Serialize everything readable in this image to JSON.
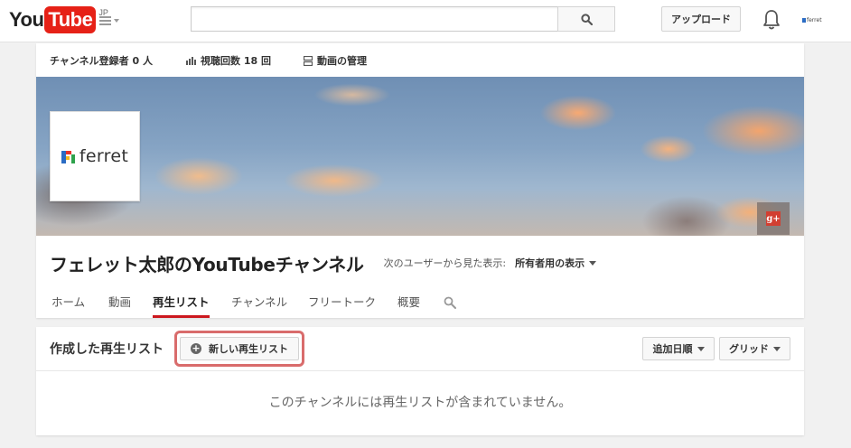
{
  "masthead": {
    "logo_you": "You",
    "logo_tube": "Tube",
    "logo_region": "JP",
    "search_placeholder": "",
    "upload_label": "アップロード",
    "account_name": "ferret"
  },
  "channel": {
    "stats": {
      "subscribers": "チャンネル登録者 0 人",
      "views": "視聴回数 18 回",
      "manage": "動画の管理"
    },
    "avatar_text": "ferret",
    "gplus_label": "g+",
    "title": "フェレット太郎のYouTubeチャンネル",
    "view_as_label": "次のユーザーから見た表示:",
    "view_as_value": "所有者用の表示",
    "tabs": [
      {
        "label": "ホーム"
      },
      {
        "label": "動画"
      },
      {
        "label": "再生リスト",
        "active": true
      },
      {
        "label": "チャンネル"
      },
      {
        "label": "フリートーク"
      },
      {
        "label": "概要"
      }
    ]
  },
  "playlists": {
    "section_title": "作成した再生リスト",
    "new_playlist_label": "新しい再生リスト",
    "sort_label": "追加日順",
    "view_label": "グリッド",
    "empty_message": "このチャンネルには再生リストが含まれていません。"
  },
  "colors": {
    "brand_red": "#e62117",
    "active_tab_underline": "#cc181e",
    "highlight_border": "#d96c6c",
    "gplus_red": "#d23f31"
  },
  "icons": [
    "menu-icon",
    "search-icon",
    "bell-icon",
    "bar-chart-icon",
    "video-manager-icon",
    "plus-circle-icon",
    "chevron-down-icon",
    "google-plus-icon"
  ]
}
